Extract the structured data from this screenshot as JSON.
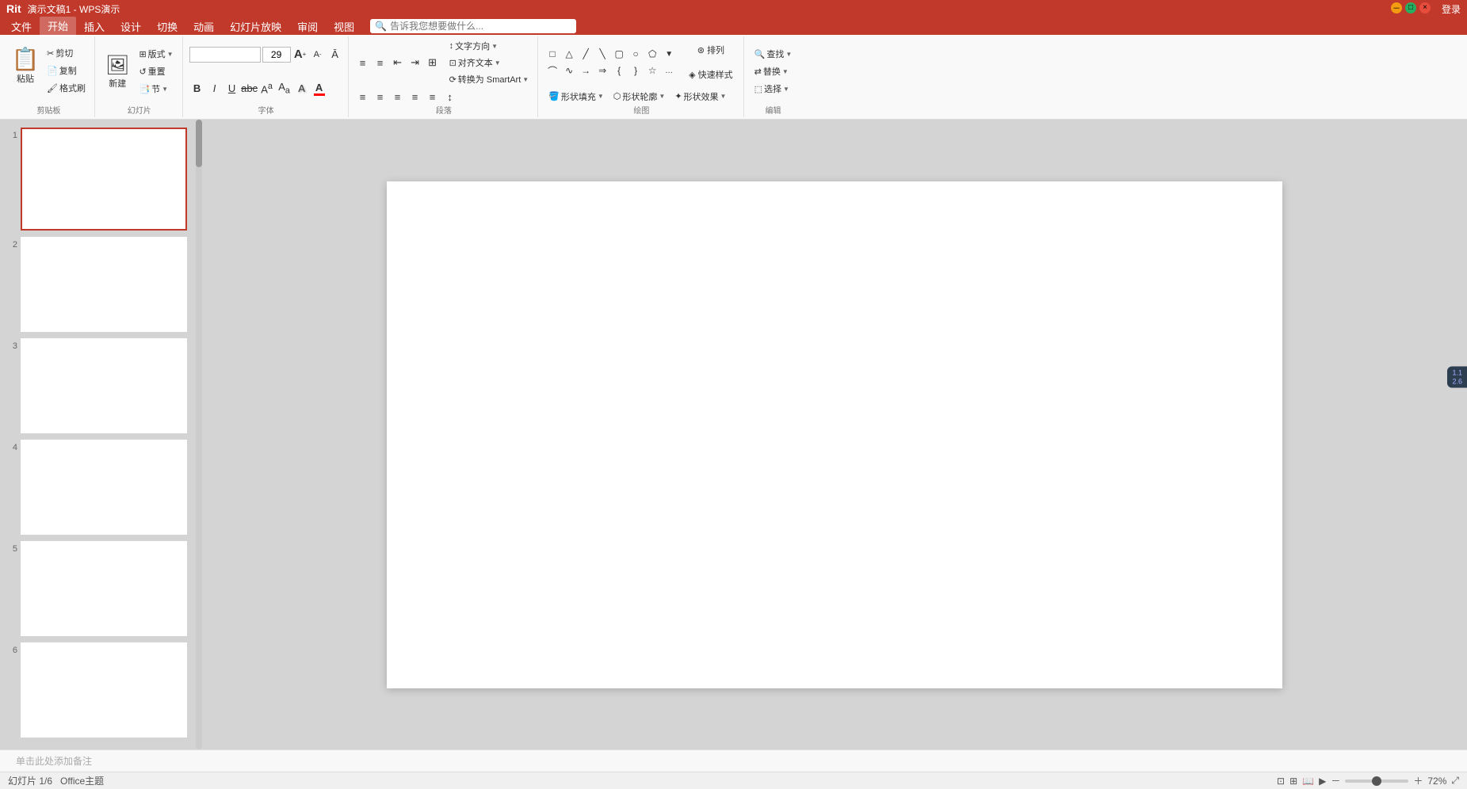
{
  "titleBar": {
    "title": "演示文稿1 - WPS演示",
    "loginLabel": "登录"
  },
  "menuBar": {
    "items": [
      {
        "id": "file",
        "label": "文件"
      },
      {
        "id": "home",
        "label": "开始",
        "active": true
      },
      {
        "id": "insert",
        "label": "插入"
      },
      {
        "id": "design",
        "label": "设计"
      },
      {
        "id": "transition",
        "label": "切换"
      },
      {
        "id": "animation",
        "label": "动画"
      },
      {
        "id": "slideshow",
        "label": "幻灯片放映"
      },
      {
        "id": "review",
        "label": "审阅"
      },
      {
        "id": "view",
        "label": "视图"
      }
    ],
    "searchPlaceholder": "告诉我您想要做什么..."
  },
  "ribbon": {
    "groups": {
      "clipboard": {
        "label": "剪贴板",
        "paste": "粘贴",
        "cut": "剪切",
        "copy": "复制",
        "formatPainter": "格式刷"
      },
      "slides": {
        "label": "幻灯片",
        "newSlide": "新建",
        "layout": "版式",
        "reset": "重置",
        "section": "节"
      },
      "font": {
        "label": "字体",
        "fontName": "",
        "fontSize": "29",
        "bold": "B",
        "italic": "I",
        "underline": "U",
        "strikethrough": "abc",
        "superscript": "A",
        "subscript": "A",
        "clearFormat": "A",
        "fontColor": "A",
        "fontColorIndicator": "#FF0000",
        "increaseFont": "A",
        "decreaseFont": "A"
      },
      "paragraph": {
        "label": "段落",
        "bulletList": "≡",
        "numberedList": "≡",
        "decreaseIndent": "⇐",
        "increaseIndent": "⇒",
        "columns": "⊞",
        "textDirection": "文字方向",
        "alignText": "对齐文本",
        "convertSmartArt": "转换为 SmartArt",
        "alignLeft": "≡",
        "alignCenter": "≡",
        "alignRight": "≡",
        "justify": "≡",
        "distributed": "≡",
        "lineSpacing": "≡"
      },
      "drawing": {
        "label": "绘图",
        "arrange": "排列",
        "quickStyles": "快速样式",
        "shapeFill": "形状填充",
        "shapeOutline": "形状轮廓",
        "shapeEffect": "形状效果"
      },
      "editing": {
        "label": "编辑",
        "find": "查找",
        "replace": "替换",
        "select": "选择"
      }
    }
  },
  "slides": [
    {
      "number": "1",
      "active": true
    },
    {
      "number": "2",
      "active": false
    },
    {
      "number": "3",
      "active": false
    },
    {
      "number": "4",
      "active": false
    },
    {
      "number": "5",
      "active": false
    },
    {
      "number": "6",
      "active": false
    }
  ],
  "statusBar": {
    "slideInfo": "幻灯片 1/6",
    "notesLabel": "单击此处添加备注",
    "theme": "Office主题",
    "zoomInfo": "72%"
  },
  "floatingBadge": {
    "line1": "1.1",
    "line2": "2.6"
  }
}
